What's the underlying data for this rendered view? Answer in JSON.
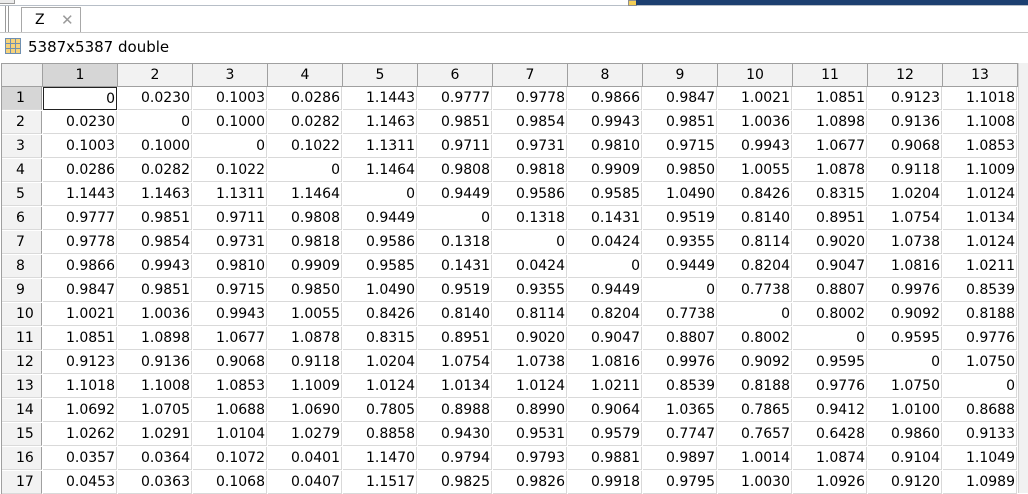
{
  "tab": {
    "label": "Z",
    "close": "✕"
  },
  "variable": {
    "size_label": "5387x5387 double",
    "icon": "table-grid-icon"
  },
  "columns": [
    "1",
    "2",
    "3",
    "4",
    "5",
    "6",
    "7",
    "8",
    "9",
    "10",
    "11",
    "12",
    "13"
  ],
  "rows": [
    {
      "label": "1",
      "cells": [
        "0",
        "0.0230",
        "0.1003",
        "0.0286",
        "1.1443",
        "0.9777",
        "0.9778",
        "0.9866",
        "0.9847",
        "1.0021",
        "1.0851",
        "0.9123",
        "1.1018"
      ]
    },
    {
      "label": "2",
      "cells": [
        "0.0230",
        "0",
        "0.1000",
        "0.0282",
        "1.1463",
        "0.9851",
        "0.9854",
        "0.9943",
        "0.9851",
        "1.0036",
        "1.0898",
        "0.9136",
        "1.1008"
      ]
    },
    {
      "label": "3",
      "cells": [
        "0.1003",
        "0.1000",
        "0",
        "0.1022",
        "1.1311",
        "0.9711",
        "0.9731",
        "0.9810",
        "0.9715",
        "0.9943",
        "1.0677",
        "0.9068",
        "1.0853"
      ]
    },
    {
      "label": "4",
      "cells": [
        "0.0286",
        "0.0282",
        "0.1022",
        "0",
        "1.1464",
        "0.9808",
        "0.9818",
        "0.9909",
        "0.9850",
        "1.0055",
        "1.0878",
        "0.9118",
        "1.1009"
      ]
    },
    {
      "label": "5",
      "cells": [
        "1.1443",
        "1.1463",
        "1.1311",
        "1.1464",
        "0",
        "0.9449",
        "0.9586",
        "0.9585",
        "1.0490",
        "0.8426",
        "0.8315",
        "1.0204",
        "1.0124"
      ]
    },
    {
      "label": "6",
      "cells": [
        "0.9777",
        "0.9851",
        "0.9711",
        "0.9808",
        "0.9449",
        "0",
        "0.1318",
        "0.1431",
        "0.9519",
        "0.8140",
        "0.8951",
        "1.0754",
        "1.0134"
      ]
    },
    {
      "label": "7",
      "cells": [
        "0.9778",
        "0.9854",
        "0.9731",
        "0.9818",
        "0.9586",
        "0.1318",
        "0",
        "0.0424",
        "0.9355",
        "0.8114",
        "0.9020",
        "1.0738",
        "1.0124"
      ]
    },
    {
      "label": "8",
      "cells": [
        "0.9866",
        "0.9943",
        "0.9810",
        "0.9909",
        "0.9585",
        "0.1431",
        "0.0424",
        "0",
        "0.9449",
        "0.8204",
        "0.9047",
        "1.0816",
        "1.0211"
      ]
    },
    {
      "label": "9",
      "cells": [
        "0.9847",
        "0.9851",
        "0.9715",
        "0.9850",
        "1.0490",
        "0.9519",
        "0.9355",
        "0.9449",
        "0",
        "0.7738",
        "0.8807",
        "0.9976",
        "0.8539"
      ]
    },
    {
      "label": "10",
      "cells": [
        "1.0021",
        "1.0036",
        "0.9943",
        "1.0055",
        "0.8426",
        "0.8140",
        "0.8114",
        "0.8204",
        "0.7738",
        "0",
        "0.8002",
        "0.9092",
        "0.8188"
      ]
    },
    {
      "label": "11",
      "cells": [
        "1.0851",
        "1.0898",
        "1.0677",
        "1.0878",
        "0.8315",
        "0.8951",
        "0.9020",
        "0.9047",
        "0.8807",
        "0.8002",
        "0",
        "0.9595",
        "0.9776"
      ]
    },
    {
      "label": "12",
      "cells": [
        "0.9123",
        "0.9136",
        "0.9068",
        "0.9118",
        "1.0204",
        "1.0754",
        "1.0738",
        "1.0816",
        "0.9976",
        "0.9092",
        "0.9595",
        "0",
        "1.0750"
      ]
    },
    {
      "label": "13",
      "cells": [
        "1.1018",
        "1.1008",
        "1.0853",
        "1.1009",
        "1.0124",
        "1.0134",
        "1.0124",
        "1.0211",
        "0.8539",
        "0.8188",
        "0.9776",
        "1.0750",
        "0"
      ]
    },
    {
      "label": "14",
      "cells": [
        "1.0692",
        "1.0705",
        "1.0688",
        "1.0690",
        "0.7805",
        "0.8988",
        "0.8990",
        "0.9064",
        "1.0365",
        "0.7865",
        "0.9412",
        "1.0100",
        "0.8688"
      ]
    },
    {
      "label": "15",
      "cells": [
        "1.0262",
        "1.0291",
        "1.0104",
        "1.0279",
        "0.8858",
        "0.9430",
        "0.9531",
        "0.9579",
        "0.7747",
        "0.7657",
        "0.6428",
        "0.9860",
        "0.9133"
      ]
    },
    {
      "label": "16",
      "cells": [
        "0.0357",
        "0.0364",
        "0.1072",
        "0.0401",
        "1.1470",
        "0.9794",
        "0.9793",
        "0.9881",
        "0.9897",
        "1.0014",
        "1.0874",
        "0.9104",
        "1.1049"
      ]
    },
    {
      "label": "17",
      "cells": [
        "0.0453",
        "0.0363",
        "0.1068",
        "0.0407",
        "1.1517",
        "0.9825",
        "0.9826",
        "0.9918",
        "0.9795",
        "1.0030",
        "1.0926",
        "0.9120",
        "1.0989"
      ]
    }
  ],
  "selected_cell": {
    "row": 1,
    "col": 1
  }
}
